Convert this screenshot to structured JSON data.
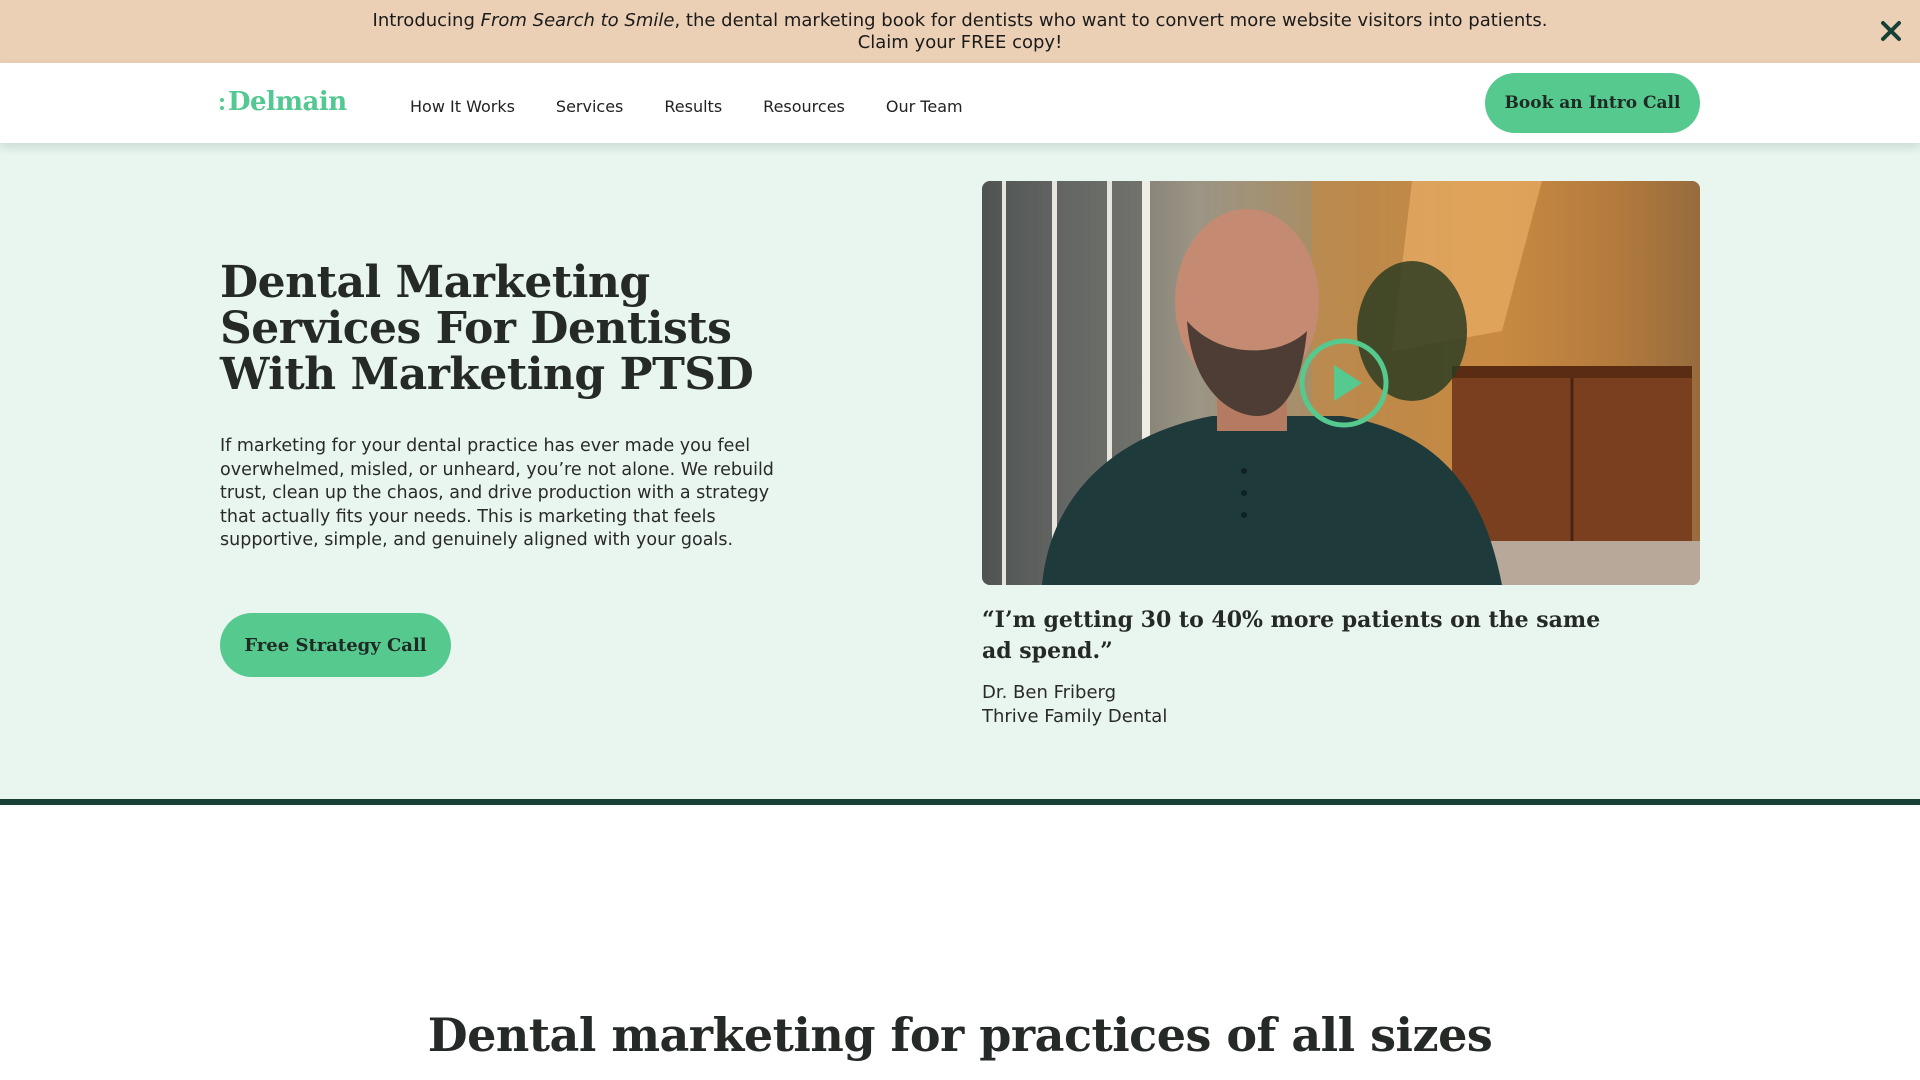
{
  "banner": {
    "prefix": "Introducing ",
    "book_title": "From Search to Smile",
    "suffix": ", the dental marketing book for dentists who want to convert more website visitors into patients.",
    "line2": "Claim your FREE copy!",
    "close_icon": "close-icon"
  },
  "header": {
    "logo": "Delmain",
    "nav": [
      {
        "label": "How It Works"
      },
      {
        "label": "Services"
      },
      {
        "label": "Results"
      },
      {
        "label": "Resources"
      },
      {
        "label": "Our Team"
      }
    ],
    "cta_label": "Book an Intro Call"
  },
  "hero": {
    "title": "Dental Marketing Services For Dentists With Marketing PTSD",
    "description": "If marketing for your dental practice has ever made you feel overwhelmed, misled, or unheard, you’re not alone. We rebuild trust, clean up the chaos, and drive production with a strategy that actually fits your needs. This is marketing that feels supportive, simple, and genuinely aligned with your goals.",
    "cta_label": "Free Strategy Call",
    "video": {
      "play_icon": "play-icon"
    },
    "testimonial": {
      "quote": "“I’m getting 30 to 40% more patients on the same ad spend.”",
      "author": "Dr. Ben Friberg",
      "practice": "Thrive Family Dental"
    }
  },
  "section": {
    "title": "Dental marketing for practices of all sizes"
  },
  "colors": {
    "accent": "#55c98e",
    "banner_bg": "#ecd0b6",
    "hero_bg": "#e8f6ef",
    "divider": "#173f36",
    "text_dark": "#262a27"
  }
}
